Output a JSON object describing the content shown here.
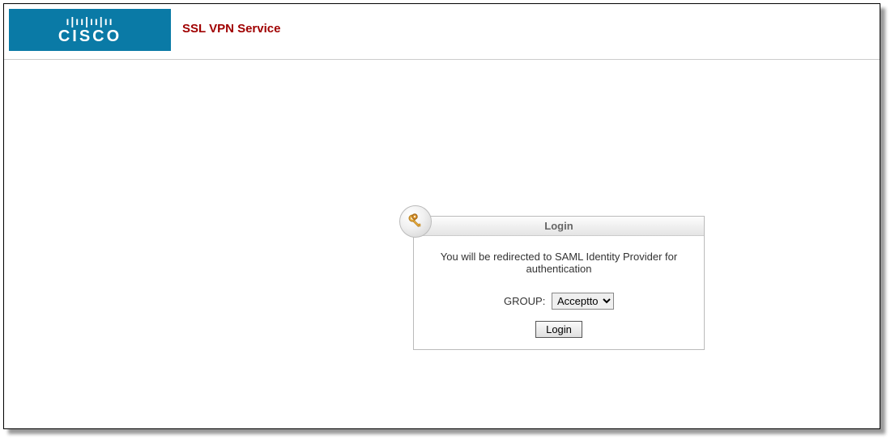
{
  "header": {
    "logo_text": "CISCO",
    "logo_bars": "ı|ıı|ıı|ıı",
    "service_title": "SSL VPN Service"
  },
  "login": {
    "panel_title": "Login",
    "redirect_msg_line1": "You will be redirected to SAML Identity Provider for",
    "redirect_msg_line2": "authentication",
    "group_label": "GROUP:",
    "group_selected": "Acceptto",
    "group_options": [
      "Acceptto"
    ],
    "login_button": "Login"
  }
}
